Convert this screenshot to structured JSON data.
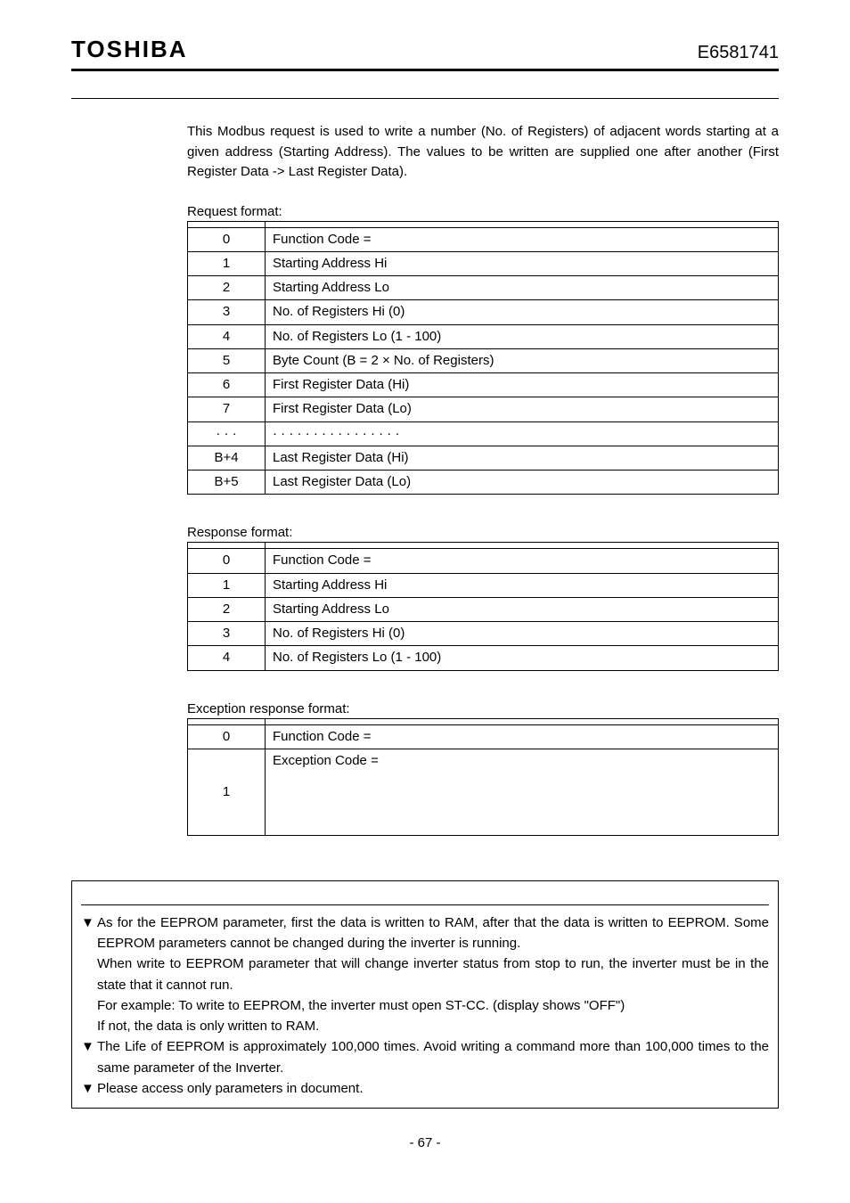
{
  "header": {
    "brand": "TOSHIBA",
    "docnum": "E6581741"
  },
  "intro": "This Modbus request is used to write a number (No. of Registers) of adjacent words starting at a given address (Starting Address). The values to be written are supplied one after another (First Register Data -> Last Register Data).",
  "captions": {
    "request": "Request format:",
    "response": "Response format:",
    "exception": "Exception response format:"
  },
  "request_rows": [
    {
      "n": "0",
      "d": "Function Code ="
    },
    {
      "n": "1",
      "d": "Starting Address Hi"
    },
    {
      "n": "2",
      "d": "Starting Address Lo"
    },
    {
      "n": "3",
      "d": "No. of Registers Hi (0)"
    },
    {
      "n": "4",
      "d": "No. of Registers Lo (1 - 100)"
    },
    {
      "n": "5",
      "d": "Byte Count (B = 2 × No. of Registers)"
    },
    {
      "n": "6",
      "d": "First Register Data (Hi)"
    },
    {
      "n": "7",
      "d": "First Register Data (Lo)"
    },
    {
      "n": "· · ·",
      "d": "· · · · · · · · · · · · · · · ·"
    },
    {
      "n": "B+4",
      "d": "Last Register Data (Hi)"
    },
    {
      "n": "B+5",
      "d": "Last Register Data (Lo)"
    }
  ],
  "response_rows": [
    {
      "n": "0",
      "d": "Function Code ="
    },
    {
      "n": "1",
      "d": "Starting Address Hi"
    },
    {
      "n": "2",
      "d": "Starting Address Lo"
    },
    {
      "n": "3",
      "d": "No. of Registers Hi (0)"
    },
    {
      "n": "4",
      "d": "No. of Registers Lo (1 - 100)"
    }
  ],
  "exception_rows": [
    {
      "n": "0",
      "d": "Function Code ="
    },
    {
      "n": "1",
      "d": "Exception Code ="
    }
  ],
  "notes": [
    "As for the EEPROM parameter, first the data is written to RAM, after that the data is written to EEPROM. Some EEPROM parameters cannot be changed during the inverter is running.\nWhen write to EEPROM parameter that will change inverter status from stop to run, the inverter must be in the state that it cannot run.\nFor example: To write to EEPROM, the inverter must open ST-CC. (display shows \"OFF\")\nIf not, the data is only written to RAM.",
    "The Life of EEPROM is approximately 100,000 times. Avoid writing a command more than 100,000 times to the same parameter of the Inverter.",
    "Please access only parameters in document."
  ],
  "marker": "▼",
  "page_number": "- 67 -"
}
